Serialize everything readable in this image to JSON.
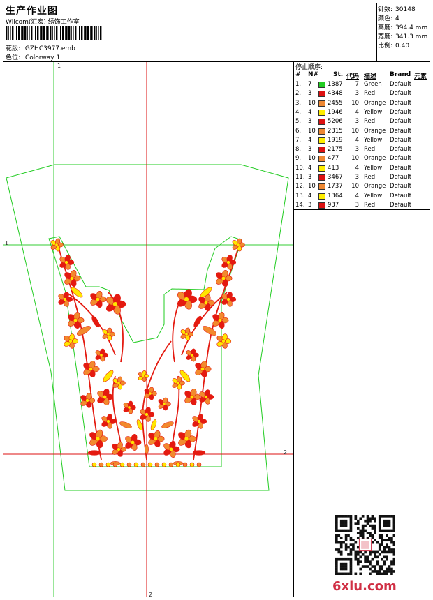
{
  "header": {
    "title": "生产作业图",
    "subtitle": "Wilcom(汇宏) 绣饰工作室",
    "pattern_label": "花版:",
    "pattern_value": "GZHC3977.emb",
    "colorway_label": "色位:",
    "colorway_value": "Colorway 1"
  },
  "stats": [
    {
      "label": "针数:",
      "value": "30148"
    },
    {
      "label": "颜色:",
      "value": "4"
    },
    {
      "label": "高度:",
      "value": "394.4 mm"
    },
    {
      "label": "宽度:",
      "value": "341.3 mm"
    },
    {
      "label": "比例:",
      "value": "0.40"
    }
  ],
  "stop_sequence": {
    "title": "停止顺序:",
    "headers": {
      "num": "#",
      "n": "N#",
      "st": "St.",
      "code": "代码",
      "desc": "描述",
      "brand": "Brand",
      "elem": "元素"
    },
    "rows": [
      {
        "i": "1.",
        "n": "7",
        "color": "#22cc22",
        "st": "1387",
        "code": "7",
        "desc": "Green",
        "brand": "Default"
      },
      {
        "i": "2.",
        "n": "3",
        "color": "#dd1111",
        "st": "4348",
        "code": "3",
        "desc": "Red",
        "brand": "Default"
      },
      {
        "i": "3.",
        "n": "10",
        "color": "#ee8833",
        "st": "2455",
        "code": "10",
        "desc": "Orange",
        "brand": "Default"
      },
      {
        "i": "4.",
        "n": "4",
        "color": "#ffee00",
        "st": "1946",
        "code": "4",
        "desc": "Yellow",
        "brand": "Default"
      },
      {
        "i": "5.",
        "n": "3",
        "color": "#dd1111",
        "st": "5206",
        "code": "3",
        "desc": "Red",
        "brand": "Default"
      },
      {
        "i": "6.",
        "n": "10",
        "color": "#ee8833",
        "st": "2315",
        "code": "10",
        "desc": "Orange",
        "brand": "Default"
      },
      {
        "i": "7.",
        "n": "4",
        "color": "#ffee00",
        "st": "1919",
        "code": "4",
        "desc": "Yellow",
        "brand": "Default"
      },
      {
        "i": "8.",
        "n": "3",
        "color": "#dd1111",
        "st": "2175",
        "code": "3",
        "desc": "Red",
        "brand": "Default"
      },
      {
        "i": "9.",
        "n": "10",
        "color": "#ee8833",
        "st": "477",
        "code": "10",
        "desc": "Orange",
        "brand": "Default"
      },
      {
        "i": "10.",
        "n": "4",
        "color": "#ffee00",
        "st": "413",
        "code": "4",
        "desc": "Yellow",
        "brand": "Default"
      },
      {
        "i": "11.",
        "n": "3",
        "color": "#dd1111",
        "st": "3467",
        "code": "3",
        "desc": "Red",
        "brand": "Default"
      },
      {
        "i": "12.",
        "n": "10",
        "color": "#ee8833",
        "st": "1737",
        "code": "10",
        "desc": "Orange",
        "brand": "Default"
      },
      {
        "i": "13.",
        "n": "4",
        "color": "#ffee00",
        "st": "1364",
        "code": "4",
        "desc": "Yellow",
        "brand": "Default"
      },
      {
        "i": "14.",
        "n": "3",
        "color": "#dd1111",
        "st": "937",
        "code": "3",
        "desc": "Red",
        "brand": "Default"
      }
    ]
  },
  "guides": {
    "v1": "1",
    "h1": "1",
    "v2": "2",
    "h2": "2"
  },
  "colors": {
    "outline": "#22cc22",
    "guide_green": "#33cc33",
    "guide_red": "#dd1111",
    "red": "#e41a10",
    "orange": "#f28a2e",
    "yellow": "#ffe600"
  },
  "watermark": "6xiu.com"
}
